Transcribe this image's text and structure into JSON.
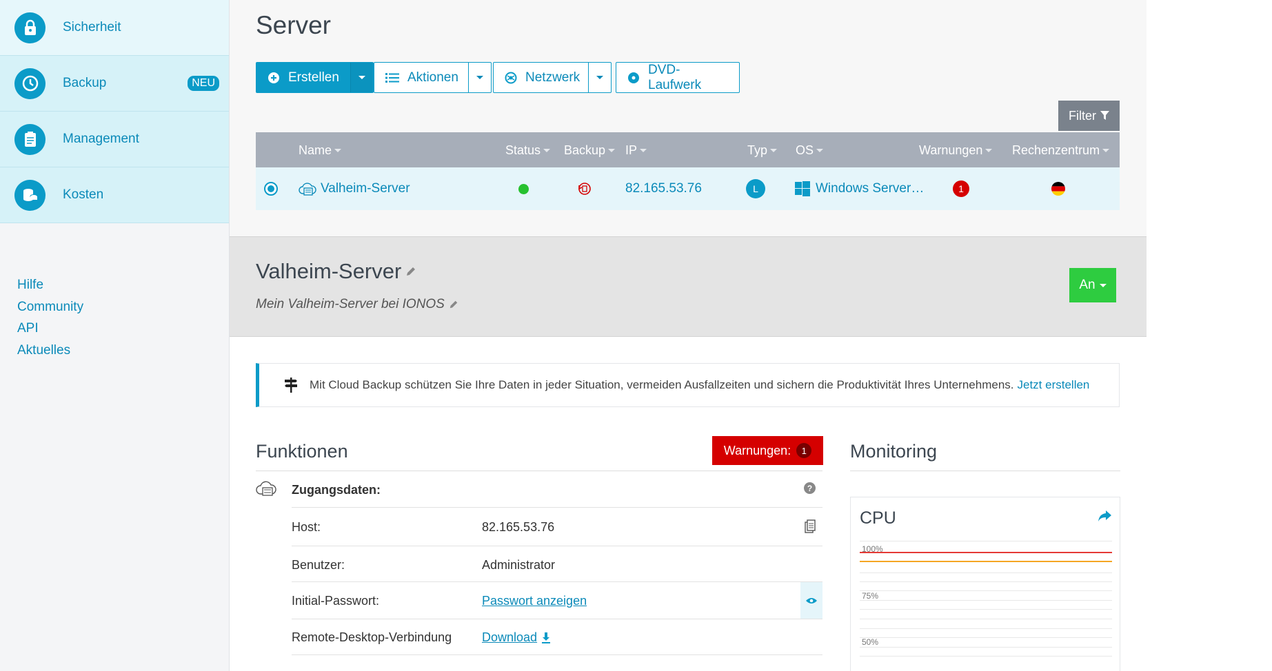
{
  "sidebar": {
    "items": [
      {
        "label": "Sicherheit",
        "icon": "lock-icon"
      },
      {
        "label": "Backup",
        "icon": "history-icon",
        "badge": "NEU"
      },
      {
        "label": "Management",
        "icon": "clipboard-icon"
      },
      {
        "label": "Kosten",
        "icon": "coins-icon"
      }
    ],
    "links": [
      "Hilfe",
      "Community",
      "API",
      "Aktuelles"
    ]
  },
  "header": {
    "title": "Server",
    "toolbar": {
      "create_label": "Erstellen",
      "actions_label": "Aktionen",
      "network_label": "Netzwerk",
      "dvd_label": "DVD-Laufwerk"
    },
    "filter_label": "Filter"
  },
  "table": {
    "columns": [
      "Name",
      "Status",
      "Backup",
      "IP",
      "Typ",
      "OS",
      "Warnungen",
      "Rechenzentrum"
    ],
    "rows": [
      {
        "name": "Valheim-Server",
        "status": "online",
        "ip": "82.165.53.76",
        "typ": "L",
        "os": "Windows Server…",
        "warnings": "1",
        "datacenter_flag": "germany-flag-icon"
      }
    ]
  },
  "detail": {
    "name": "Valheim-Server",
    "description": "Mein Valheim-Server bei IONOS",
    "power_label": "An"
  },
  "notice": {
    "text": "Mit Cloud Backup schützen Sie Ihre Daten in jeder Situation, vermeiden Ausfallzeiten und sichern die Produktivität Ihres Unternehmens.",
    "link": "Jetzt erstellen"
  },
  "funktionen": {
    "title": "Funktionen",
    "warnings_label": "Warnungen:",
    "warnings_count": "1",
    "section_label": "Zugangsdaten:",
    "rows": [
      {
        "label": "Host:",
        "value": "82.165.53.76"
      },
      {
        "label": "Benutzer:",
        "value": "Administrator"
      },
      {
        "label": "Initial-Passwort:",
        "value": "Passwort anzeigen"
      },
      {
        "label": "Remote-Desktop-Verbindung",
        "value": "Download"
      }
    ]
  },
  "monitoring": {
    "title": "Monitoring",
    "cpu_title": "CPU",
    "grid_labels": [
      "100%",
      "75%",
      "50%"
    ]
  },
  "colors": {
    "accent": "#0b9bc8",
    "danger": "#d50000",
    "success": "#2ecc40",
    "table_header": "#a7aeb9"
  }
}
